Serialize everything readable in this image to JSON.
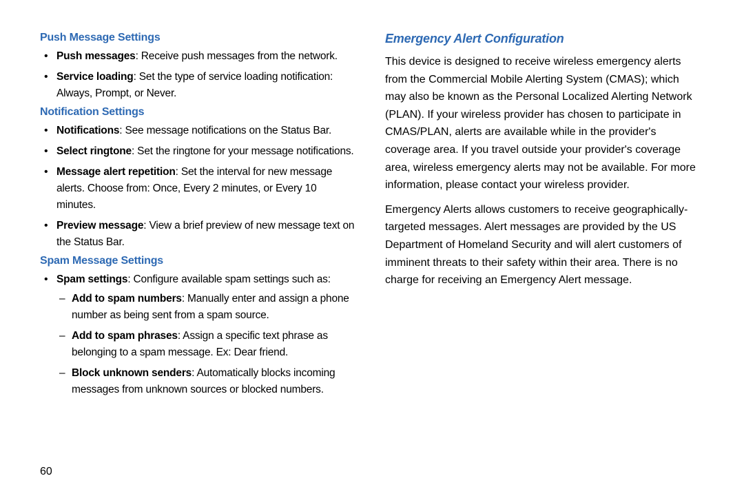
{
  "pageNumber": "60",
  "left": {
    "push": {
      "heading": "Push Message Settings",
      "items": [
        {
          "bold": "Push messages",
          "rest": ": Receive push messages from the network."
        },
        {
          "bold": "Service loading",
          "rest": ": Set the type of service loading notification: Always, Prompt, or Never."
        }
      ]
    },
    "notif": {
      "heading": "Notification Settings",
      "items": [
        {
          "bold": "Notifications",
          "rest": ": See message notifications on the Status Bar."
        },
        {
          "bold": "Select ringtone",
          "rest": ": Set the ringtone for your message notifications."
        },
        {
          "bold": "Message alert repetition",
          "rest": ": Set the interval for new message alerts. Choose from: Once, Every 2 minutes, or Every 10 minutes."
        },
        {
          "bold": "Preview message",
          "rest": ": View a brief preview of new message text on the Status Bar."
        }
      ]
    },
    "spam": {
      "heading": "Spam Message Settings",
      "lead": {
        "bold": "Spam settings",
        "rest": ": Configure available spam settings such as:"
      },
      "sub": [
        {
          "bold": "Add to spam numbers",
          "rest": ": Manually enter and assign a phone number as being sent from a spam source."
        },
        {
          "bold": "Add to spam phrases",
          "rest": ": Assign a specific text phrase as belonging to a spam message. Ex: Dear friend."
        },
        {
          "bold": "Block unknown senders",
          "rest": ": Automatically blocks incoming messages from unknown sources or blocked numbers."
        }
      ]
    }
  },
  "right": {
    "heading": "Emergency Alert Configuration",
    "p1": "This device is designed to receive wireless emergency alerts from the Commercial Mobile Alerting System (CMAS); which may also be known as the Personal Localized Alerting Network (PLAN). If your wireless provider has chosen to participate in CMAS/PLAN, alerts are available while in the provider's coverage area. If you travel outside your provider's coverage area, wireless emergency alerts may not be available. For more information, please contact your wireless provider.",
    "p2": "Emergency Alerts allows customers to receive geographically-targeted messages. Alert messages are provided by the US Department of Homeland Security and will alert customers of imminent threats to their safety within their area. There is no charge for receiving an Emergency Alert message."
  }
}
